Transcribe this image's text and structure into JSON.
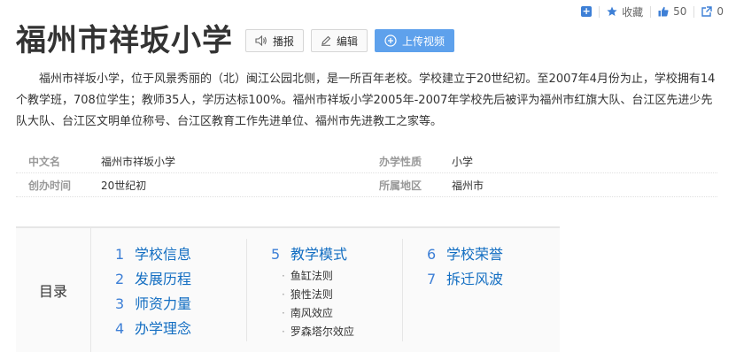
{
  "topbar": {
    "add_label": "+",
    "favorite_label": "收藏",
    "like_count": "50",
    "share_count": "0"
  },
  "title": "福州市祥坂小学",
  "buttons": {
    "broadcast": "播报",
    "edit": "编辑",
    "upload_video": "上传视频"
  },
  "summary": "福州市祥坂小学，位于风景秀丽的（北）闽江公园北侧，是一所百年老校。学校建立于20世纪初。至2007年4月份为止，学校拥有14个教学班，708位学生；教师35人，学历达标100%。福州市祥坂小学2005年-2007年学校先后被评为福州市红旗大队、台江区先进少先队大队、台江区文明单位称号、台江区教育工作先进单位、福州市先进教工之家等。",
  "info": [
    {
      "k1": "中文名",
      "v1": "福州市祥坂小学",
      "k2": "办学性质",
      "v2": "小学"
    },
    {
      "k1": "创办时间",
      "v1": "20世纪初",
      "k2": "所属地区",
      "v2": "福州市"
    }
  ],
  "catalog": {
    "label": "目录",
    "col1": [
      {
        "num": "1",
        "text": "学校信息"
      },
      {
        "num": "2",
        "text": "发展历程"
      },
      {
        "num": "3",
        "text": "师资力量"
      },
      {
        "num": "4",
        "text": "办学理念"
      }
    ],
    "col2_main": {
      "num": "5",
      "text": "教学模式"
    },
    "col2_subs": [
      "鱼缸法则",
      "狼性法则",
      "南风效应",
      "罗森塔尔效应"
    ],
    "col3": [
      {
        "num": "6",
        "text": "学校荣誉"
      },
      {
        "num": "7",
        "text": "拆迁风波"
      }
    ]
  },
  "colors": {
    "accent": "#3d7fd6",
    "primary_button": "#5ea1ec",
    "link": "#136ec2"
  }
}
